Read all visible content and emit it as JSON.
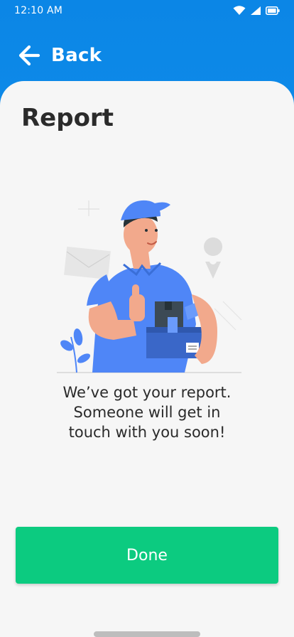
{
  "status_bar": {
    "time": "12:10 AM",
    "icons": [
      "wifi-icon",
      "signal-icon",
      "battery-icon"
    ]
  },
  "header": {
    "back_label": "Back",
    "back_icon": "arrow-left-icon"
  },
  "page": {
    "title": "Report",
    "message_lines": [
      "We’ve got your report.",
      "Someone will get in",
      "touch with you soon!"
    ]
  },
  "actions": {
    "done_label": "Done"
  },
  "colors": {
    "header_blue": "#0b86e6",
    "accent_green": "#0ccb80",
    "card_background": "#f6f6f6",
    "illustration_blue": "#4f86f7"
  }
}
